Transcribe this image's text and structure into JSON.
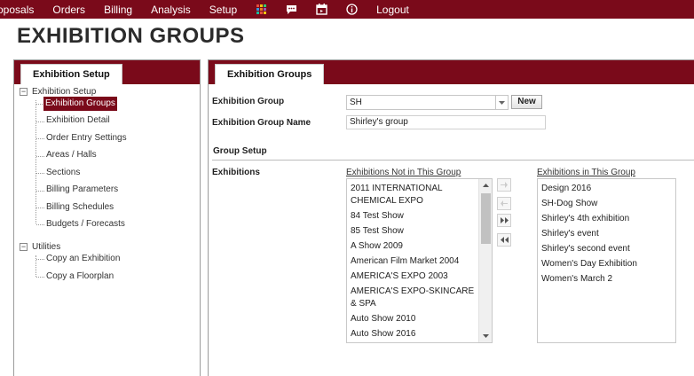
{
  "nav": {
    "items": [
      "oposals",
      "Orders",
      "Billing",
      "Analysis",
      "Setup"
    ],
    "icons": [
      "grid-icon",
      "chat-icon",
      "calendar-icon",
      "info-icon"
    ],
    "logout": "Logout"
  },
  "page_title": "EXHIBITION GROUPS",
  "left": {
    "tab": "Exhibition Setup",
    "tree": {
      "group1": "Exhibition Setup",
      "group1_items": [
        "Exhibition Groups",
        "Exhibition Detail",
        "Order Entry Settings",
        "Areas / Halls",
        "Sections",
        "Billing Parameters",
        "Billing Schedules",
        "Budgets / Forecasts"
      ],
      "group2": "Utilities",
      "group2_items": [
        "Copy an Exhibition",
        "Copy a Floorplan"
      ],
      "selected": "Exhibition Groups"
    }
  },
  "right": {
    "tab": "Exhibition Groups",
    "group_label": "Exhibition Group",
    "group_value": "SH",
    "new_button": "New",
    "name_label": "Exhibition Group Name",
    "name_value": "Shirley's group",
    "section": "Group Setup",
    "exhibitions_label": "Exhibitions",
    "not_in_caption": "Exhibitions Not in This Group",
    "in_caption": "Exhibitions in This Group",
    "not_in": [
      "2011 INTERNATIONAL CHEMICAL EXPO",
      "84 Test Show",
      "85 Test Show",
      "A Show 2009",
      "American Film Market 2004",
      "AMERICA'S EXPO 2003",
      "AMERICA'S EXPO-SKINCARE & SPA",
      "Auto Show 2010",
      "Auto Show 2016"
    ],
    "in": [
      "Design 2016",
      "SH-Dog Show",
      "Shirley's 4th exhibition",
      "Shirley's event",
      "Shirley's second event",
      "Women's Day Exhibition",
      "Women's March 2"
    ]
  },
  "colors": {
    "brand": "#7a0a1a"
  }
}
